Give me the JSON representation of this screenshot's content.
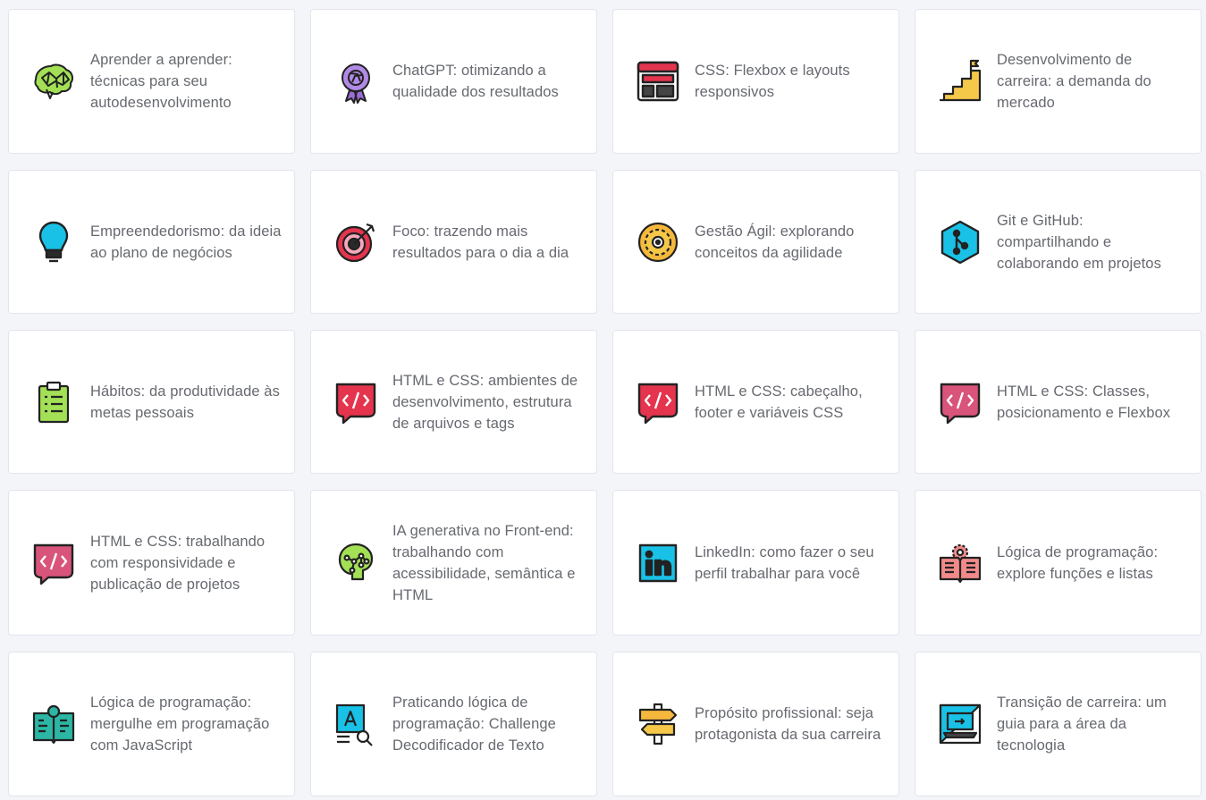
{
  "courses": [
    {
      "title": "Aprender a aprender: técnicas para seu autodesenvolvimento",
      "icon": "brain-icon"
    },
    {
      "title": "ChatGPT: otimizando a qualidade dos resultados",
      "icon": "chatgpt-badge-icon"
    },
    {
      "title": "CSS: Flexbox e layouts responsivos",
      "icon": "flexbox-layout-icon"
    },
    {
      "title": "Desenvolvimento de carreira: a demanda do mercado",
      "icon": "stairs-flag-icon"
    },
    {
      "title": "Empreendedorismo: da ideia ao plano de negócios",
      "icon": "lightbulb-icon"
    },
    {
      "title": "Foco: trazendo mais resultados para o dia a dia",
      "icon": "target-icon"
    },
    {
      "title": "Gestão Ágil: explorando conceitos da agilidade",
      "icon": "agile-gear-icon"
    },
    {
      "title": "Git e GitHub: compartilhando e colaborando em projetos",
      "icon": "git-hexagon-icon"
    },
    {
      "title": "Hábitos: da produtividade às metas pessoais",
      "icon": "clipboard-icon"
    },
    {
      "title": "HTML e CSS: ambientes de desenvolvimento, estrutura de arquivos e tags",
      "icon": "html-code-icon"
    },
    {
      "title": "HTML e CSS: cabeçalho, footer e variáveis CSS",
      "icon": "html-code-icon"
    },
    {
      "title": "HTML e CSS: Classes, posicionamento e Flexbox",
      "icon": "html-code-icon"
    },
    {
      "title": "HTML e CSS: trabalhando com responsividade e publicação de projetos",
      "icon": "html-code-icon"
    },
    {
      "title": "IA generativa no Front-end: trabalhando com acessibilidade, semântica e HTML",
      "icon": "ai-brain-circuit-icon"
    },
    {
      "title": "LinkedIn: como fazer o seu perfil trabalhar para você",
      "icon": "linkedin-icon"
    },
    {
      "title": "Lógica de programação: explore funções e listas",
      "icon": "open-book-gear-icon"
    },
    {
      "title": "Lógica de programação: mergulhe em programação com JavaScript",
      "icon": "code-book-icon"
    },
    {
      "title": "Praticando lógica de programação: Challenge Decodificador de Texto",
      "icon": "text-search-icon"
    },
    {
      "title": "Propósito profissional: seja protagonista da sua carreira",
      "icon": "signpost-icon"
    },
    {
      "title": "Transição de carreira: um guia para a área da tecnologia",
      "icon": "laptop-transition-icon"
    }
  ],
  "colors": {
    "card_bg": "#ffffff",
    "page_bg": "#f4f5f9",
    "title_text": "#66696f",
    "html_icon_red": "#e5344e",
    "html_icon_pink": "#d9547a",
    "accent_cyan": "#19c1e6",
    "accent_green": "#8fd14f"
  }
}
